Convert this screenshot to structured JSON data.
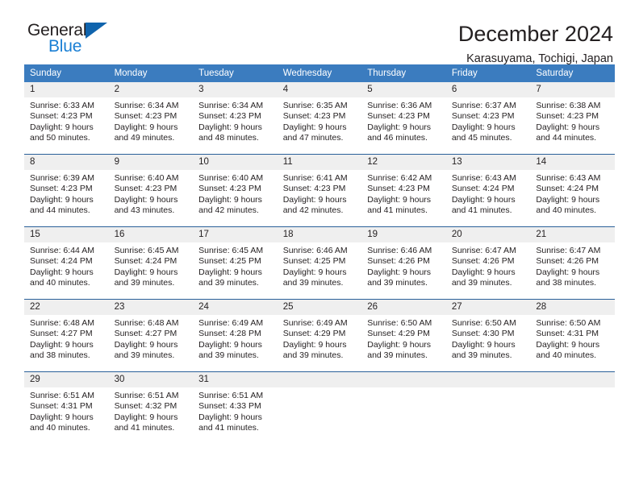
{
  "brand": {
    "name_part1": "General",
    "name_part2": "Blue",
    "flag_icon": "triangle-flag-icon",
    "colors": {
      "text": "#231f20",
      "blue": "#1a7fd4",
      "flag": "#1064ad"
    }
  },
  "header": {
    "title": "December 2024",
    "subtitle": "Karasuyama, Tochigi, Japan"
  },
  "theme": {
    "header_bg": "#3b7cbf",
    "header_text": "#ffffff",
    "daynum_bg": "#efefef",
    "cell_border": "#2a6099",
    "cell_bg": "#ffffff"
  },
  "weekdays": [
    "Sunday",
    "Monday",
    "Tuesday",
    "Wednesday",
    "Thursday",
    "Friday",
    "Saturday"
  ],
  "labels": {
    "sunrise_prefix": "Sunrise:",
    "sunset_prefix": "Sunset:",
    "daylight_prefix": "Daylight:"
  },
  "weeks": [
    [
      {
        "day": "1",
        "sunrise": "Sunrise: 6:33 AM",
        "sunset": "Sunset: 4:23 PM",
        "daylight1": "Daylight: 9 hours",
        "daylight2": "and 50 minutes."
      },
      {
        "day": "2",
        "sunrise": "Sunrise: 6:34 AM",
        "sunset": "Sunset: 4:23 PM",
        "daylight1": "Daylight: 9 hours",
        "daylight2": "and 49 minutes."
      },
      {
        "day": "3",
        "sunrise": "Sunrise: 6:34 AM",
        "sunset": "Sunset: 4:23 PM",
        "daylight1": "Daylight: 9 hours",
        "daylight2": "and 48 minutes."
      },
      {
        "day": "4",
        "sunrise": "Sunrise: 6:35 AM",
        "sunset": "Sunset: 4:23 PM",
        "daylight1": "Daylight: 9 hours",
        "daylight2": "and 47 minutes."
      },
      {
        "day": "5",
        "sunrise": "Sunrise: 6:36 AM",
        "sunset": "Sunset: 4:23 PM",
        "daylight1": "Daylight: 9 hours",
        "daylight2": "and 46 minutes."
      },
      {
        "day": "6",
        "sunrise": "Sunrise: 6:37 AM",
        "sunset": "Sunset: 4:23 PM",
        "daylight1": "Daylight: 9 hours",
        "daylight2": "and 45 minutes."
      },
      {
        "day": "7",
        "sunrise": "Sunrise: 6:38 AM",
        "sunset": "Sunset: 4:23 PM",
        "daylight1": "Daylight: 9 hours",
        "daylight2": "and 44 minutes."
      }
    ],
    [
      {
        "day": "8",
        "sunrise": "Sunrise: 6:39 AM",
        "sunset": "Sunset: 4:23 PM",
        "daylight1": "Daylight: 9 hours",
        "daylight2": "and 44 minutes."
      },
      {
        "day": "9",
        "sunrise": "Sunrise: 6:40 AM",
        "sunset": "Sunset: 4:23 PM",
        "daylight1": "Daylight: 9 hours",
        "daylight2": "and 43 minutes."
      },
      {
        "day": "10",
        "sunrise": "Sunrise: 6:40 AM",
        "sunset": "Sunset: 4:23 PM",
        "daylight1": "Daylight: 9 hours",
        "daylight2": "and 42 minutes."
      },
      {
        "day": "11",
        "sunrise": "Sunrise: 6:41 AM",
        "sunset": "Sunset: 4:23 PM",
        "daylight1": "Daylight: 9 hours",
        "daylight2": "and 42 minutes."
      },
      {
        "day": "12",
        "sunrise": "Sunrise: 6:42 AM",
        "sunset": "Sunset: 4:23 PM",
        "daylight1": "Daylight: 9 hours",
        "daylight2": "and 41 minutes."
      },
      {
        "day": "13",
        "sunrise": "Sunrise: 6:43 AM",
        "sunset": "Sunset: 4:24 PM",
        "daylight1": "Daylight: 9 hours",
        "daylight2": "and 41 minutes."
      },
      {
        "day": "14",
        "sunrise": "Sunrise: 6:43 AM",
        "sunset": "Sunset: 4:24 PM",
        "daylight1": "Daylight: 9 hours",
        "daylight2": "and 40 minutes."
      }
    ],
    [
      {
        "day": "15",
        "sunrise": "Sunrise: 6:44 AM",
        "sunset": "Sunset: 4:24 PM",
        "daylight1": "Daylight: 9 hours",
        "daylight2": "and 40 minutes."
      },
      {
        "day": "16",
        "sunrise": "Sunrise: 6:45 AM",
        "sunset": "Sunset: 4:24 PM",
        "daylight1": "Daylight: 9 hours",
        "daylight2": "and 39 minutes."
      },
      {
        "day": "17",
        "sunrise": "Sunrise: 6:45 AM",
        "sunset": "Sunset: 4:25 PM",
        "daylight1": "Daylight: 9 hours",
        "daylight2": "and 39 minutes."
      },
      {
        "day": "18",
        "sunrise": "Sunrise: 6:46 AM",
        "sunset": "Sunset: 4:25 PM",
        "daylight1": "Daylight: 9 hours",
        "daylight2": "and 39 minutes."
      },
      {
        "day": "19",
        "sunrise": "Sunrise: 6:46 AM",
        "sunset": "Sunset: 4:26 PM",
        "daylight1": "Daylight: 9 hours",
        "daylight2": "and 39 minutes."
      },
      {
        "day": "20",
        "sunrise": "Sunrise: 6:47 AM",
        "sunset": "Sunset: 4:26 PM",
        "daylight1": "Daylight: 9 hours",
        "daylight2": "and 39 minutes."
      },
      {
        "day": "21",
        "sunrise": "Sunrise: 6:47 AM",
        "sunset": "Sunset: 4:26 PM",
        "daylight1": "Daylight: 9 hours",
        "daylight2": "and 38 minutes."
      }
    ],
    [
      {
        "day": "22",
        "sunrise": "Sunrise: 6:48 AM",
        "sunset": "Sunset: 4:27 PM",
        "daylight1": "Daylight: 9 hours",
        "daylight2": "and 38 minutes."
      },
      {
        "day": "23",
        "sunrise": "Sunrise: 6:48 AM",
        "sunset": "Sunset: 4:27 PM",
        "daylight1": "Daylight: 9 hours",
        "daylight2": "and 39 minutes."
      },
      {
        "day": "24",
        "sunrise": "Sunrise: 6:49 AM",
        "sunset": "Sunset: 4:28 PM",
        "daylight1": "Daylight: 9 hours",
        "daylight2": "and 39 minutes."
      },
      {
        "day": "25",
        "sunrise": "Sunrise: 6:49 AM",
        "sunset": "Sunset: 4:29 PM",
        "daylight1": "Daylight: 9 hours",
        "daylight2": "and 39 minutes."
      },
      {
        "day": "26",
        "sunrise": "Sunrise: 6:50 AM",
        "sunset": "Sunset: 4:29 PM",
        "daylight1": "Daylight: 9 hours",
        "daylight2": "and 39 minutes."
      },
      {
        "day": "27",
        "sunrise": "Sunrise: 6:50 AM",
        "sunset": "Sunset: 4:30 PM",
        "daylight1": "Daylight: 9 hours",
        "daylight2": "and 39 minutes."
      },
      {
        "day": "28",
        "sunrise": "Sunrise: 6:50 AM",
        "sunset": "Sunset: 4:31 PM",
        "daylight1": "Daylight: 9 hours",
        "daylight2": "and 40 minutes."
      }
    ],
    [
      {
        "day": "29",
        "sunrise": "Sunrise: 6:51 AM",
        "sunset": "Sunset: 4:31 PM",
        "daylight1": "Daylight: 9 hours",
        "daylight2": "and 40 minutes."
      },
      {
        "day": "30",
        "sunrise": "Sunrise: 6:51 AM",
        "sunset": "Sunset: 4:32 PM",
        "daylight1": "Daylight: 9 hours",
        "daylight2": "and 41 minutes."
      },
      {
        "day": "31",
        "sunrise": "Sunrise: 6:51 AM",
        "sunset": "Sunset: 4:33 PM",
        "daylight1": "Daylight: 9 hours",
        "daylight2": "and 41 minutes."
      },
      {
        "day": "",
        "sunrise": "",
        "sunset": "",
        "daylight1": "",
        "daylight2": ""
      },
      {
        "day": "",
        "sunrise": "",
        "sunset": "",
        "daylight1": "",
        "daylight2": ""
      },
      {
        "day": "",
        "sunrise": "",
        "sunset": "",
        "daylight1": "",
        "daylight2": ""
      },
      {
        "day": "",
        "sunrise": "",
        "sunset": "",
        "daylight1": "",
        "daylight2": ""
      }
    ]
  ]
}
